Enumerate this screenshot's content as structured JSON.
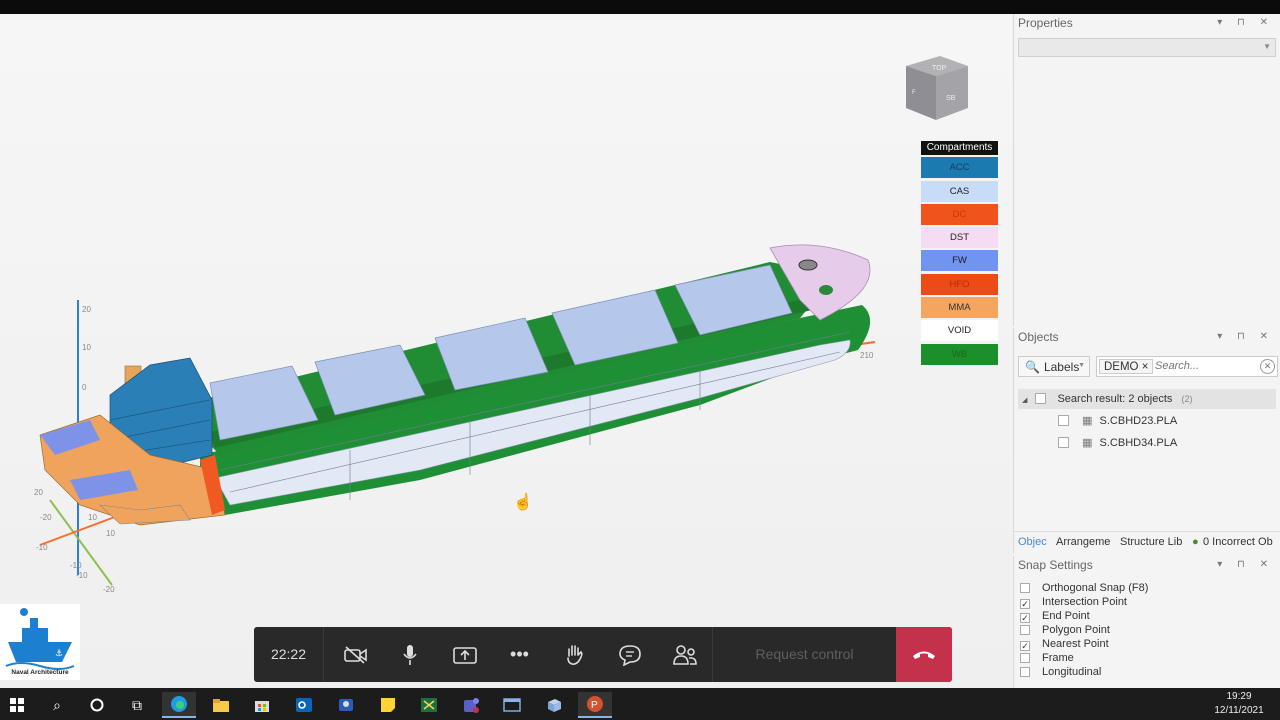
{
  "viewport": {
    "view_cube": {
      "top": "TOP",
      "front": "SB",
      "side": "F"
    },
    "axis_ticks": {
      "vertical": [
        "20",
        "10",
        "0"
      ],
      "green": [
        "10",
        "-10",
        "-20"
      ],
      "other": [
        "20",
        "-10",
        "-20",
        "10",
        "-10",
        "210"
      ]
    },
    "legend": {
      "title": "Compartments",
      "items": [
        {
          "label": "ACC",
          "color": "#1b7bb0",
          "text_color": "#123e66"
        },
        {
          "label": "CAS",
          "color": "#c6dcf7",
          "text_color": "#222222"
        },
        {
          "label": "DC",
          "color": "#f0531c",
          "text_color": "#c8360e"
        },
        {
          "label": "DST",
          "color": "#f6dcf3",
          "text_color": "#222222"
        },
        {
          "label": "FW",
          "color": "#6f95f0",
          "text_color": "#1a1a2e"
        },
        {
          "label": "HFO",
          "color": "#ec4b18",
          "text_color": "#b52e06"
        },
        {
          "label": "MMA",
          "color": "#f4a560",
          "text_color": "#333333"
        },
        {
          "label": "VOID",
          "color": "#ffffff",
          "text_color": "#222222"
        },
        {
          "label": "WB",
          "color": "#1b8f2a",
          "text_color": "#146b1f"
        }
      ]
    }
  },
  "properties": {
    "title": "Properties",
    "controls": "▾ ⊓ ✕"
  },
  "objects": {
    "title": "Objects",
    "controls": "▾ ⊓ ✕",
    "filter_label": "Labels",
    "tag": "DEMO",
    "tag_close": "×",
    "search_placeholder": "Search...",
    "search_result": "Search result: 2 objects",
    "search_count": "(2)",
    "items": [
      "S.CBHD23.PLA",
      "S.CBHD34.PLA"
    ],
    "tabs": [
      "Objec",
      "Arrangeme",
      "Structure Lib",
      "0 Incorrect Ob"
    ]
  },
  "snap": {
    "title": "Snap Settings",
    "controls": "▾ ⊓ ✕",
    "items": [
      {
        "label": "Orthogonal Snap (F8)",
        "checked": false
      },
      {
        "label": "Intersection Point",
        "checked": true
      },
      {
        "label": "End Point",
        "checked": true
      },
      {
        "label": "Polygon Point",
        "checked": false
      },
      {
        "label": "Nearest Point",
        "checked": true
      },
      {
        "label": "Frame",
        "checked": false
      },
      {
        "label": "Longitudinal",
        "checked": false
      }
    ]
  },
  "logo": {
    "text": "Naval Architecture"
  },
  "call": {
    "timer": "22:22",
    "request_control": "Request control"
  },
  "taskbar": {
    "time": "19:29",
    "date": "12/11/2021"
  }
}
